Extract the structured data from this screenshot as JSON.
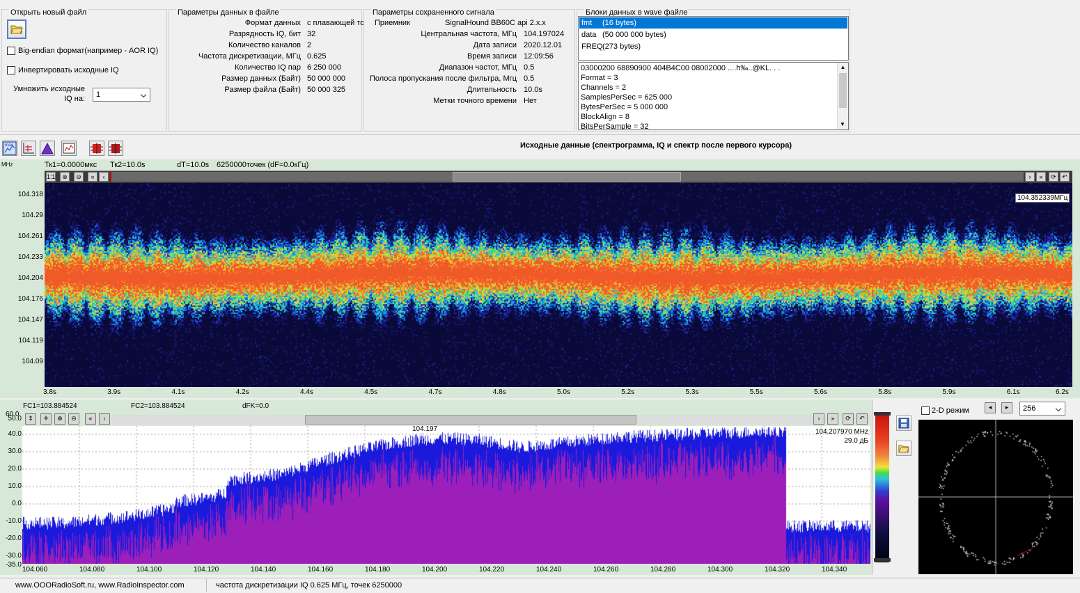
{
  "open_file": {
    "title": "Открыть новый файл",
    "big_endian_label": "Big-endian формат(например - AOR IQ)",
    "invert_label": "Инвертировать исходные IQ",
    "multiply_label_1": "Умножить исходные",
    "multiply_label_2": "IQ на:",
    "multiply_value": "1"
  },
  "file_params": {
    "title": "Параметры данных в файле",
    "rows": [
      {
        "label": "Формат данных",
        "value": "с плавающей точкой"
      },
      {
        "label": "Разрядность IQ, бит",
        "value": "32"
      },
      {
        "label": "Количество каналов",
        "value": "2"
      },
      {
        "label": "Частота дискретизации, МГц",
        "value": "0.625"
      },
      {
        "label": "Количество IQ пар",
        "value": "6 250 000"
      },
      {
        "label": "Размер данных (Байт)",
        "value": "50 000 000"
      },
      {
        "label": "Размер файла (Байт)",
        "value": "50 000 325"
      }
    ]
  },
  "signal_params": {
    "title": "Параметры сохраненного сигнала",
    "receiver_label": "Приемник",
    "receiver_value": "SignalHound BB60C api 2.x.x",
    "rows": [
      {
        "label": "Центральная частота, МГц",
        "value": "104.197024"
      },
      {
        "label": "Дата записи",
        "value": "2020.12.01"
      },
      {
        "label": "Время записи",
        "value": "12:09:56"
      },
      {
        "label": "Диапазон частот, МГц",
        "value": "0.5"
      },
      {
        "label": "Полоса пропускания после фильтра, Мгц",
        "value": "0.5"
      },
      {
        "label": "Длительность",
        "value": "10.0s"
      },
      {
        "label": "Метки точного времени",
        "value": "Нет"
      }
    ]
  },
  "wave_blocks": {
    "title": "Блоки данных в wave файле",
    "items": [
      {
        "name": "fmt",
        "size": "(16 bytes)"
      },
      {
        "name": "data",
        "size": "(50 000 000 bytes)"
      },
      {
        "name": "FREQ",
        "size": "(273 bytes)"
      }
    ],
    "detail_lines": [
      "03000200 68890900 404B4C00 08002000       ....h‰..@KL. . .",
      "Format = 3",
      "Channels = 2",
      "SamplesPerSec = 625 000",
      "BytesPerSec = 5 000 000",
      "BlockAlign = 8",
      "BitsPerSample = 32"
    ]
  },
  "toolbar": {
    "title": "Исходные данные (спектрограмма, IQ и спектр после первого курсора)",
    "max_label": "max"
  },
  "spectrogram": {
    "unit": "MHz",
    "tk1": "Тк1=0.0000мкс",
    "tk2": "Тк2=10.0s",
    "dt": "dT=10.0s",
    "points": "6250000точек (dF=0.0кГц)",
    "cursor_readout": "104.352339МГц",
    "y_ticks": [
      "104.318",
      "104.29",
      "104.261",
      "104.233",
      "104.204",
      "104.176",
      "104.147",
      "104.119",
      "104.09"
    ],
    "x_ticks": [
      "3.8s",
      "3.9s",
      "4.1s",
      "4.2s",
      "4.4s",
      "4.5s",
      "4.7s",
      "4.8s",
      "5.0s",
      "5.2s",
      "5.3s",
      "5.5s",
      "5.6s",
      "5.8s",
      "5.9s",
      "6.1s",
      "6.2s"
    ]
  },
  "spectrum": {
    "fc1": "FC1=103.884524",
    "fc2": "FC2=103.884524",
    "dfk": "dFK=0.0",
    "peak_label": "104.197",
    "readout_freq": "104.207970 MHz",
    "readout_db": "29.0 дБ",
    "y_ticks": [
      "50.0",
      "40.0",
      "30.0",
      "20.0",
      "10.0",
      "0.0",
      "-10.0",
      "-20.0",
      "-30.0",
      "-35.0"
    ],
    "y_top_label": "60.0",
    "x_ticks": [
      "104.060",
      "104.080",
      "104.100",
      "104.120",
      "104.140",
      "104.160",
      "104.180",
      "104.200",
      "104.220",
      "104.240",
      "104.260",
      "104.280",
      "104.300",
      "104.320",
      "104.340"
    ]
  },
  "iq_panel": {
    "mode_label": "2-D режим",
    "size_value": "256"
  },
  "status_bar": {
    "site": "www.OOORadioSoft.ru, www.RadioInspector.com",
    "info": "частота дискретизации IQ 0.625 МГц, точек 6250000"
  },
  "colors": {
    "spectrum_fill": "#9b1fb8",
    "spectrum_envelope": "#1a1adc",
    "selection": "#0078d7",
    "spectrogram_bg": "#0a0a3a"
  }
}
